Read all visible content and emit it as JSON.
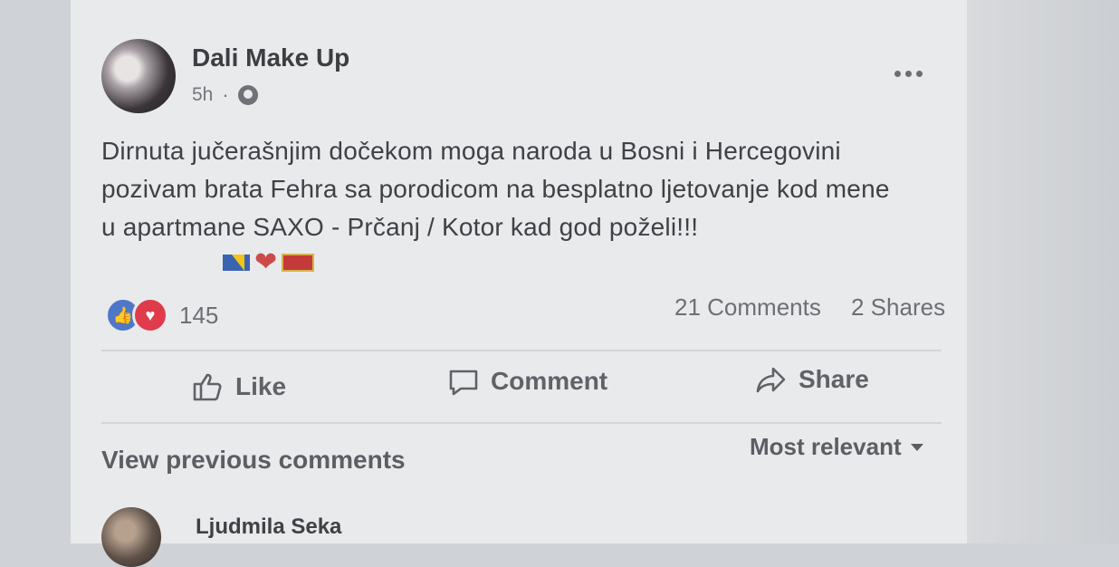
{
  "post": {
    "author": "Dali Make Up",
    "time": "5h",
    "separator": "·",
    "text_lines": [
      "Dirnuta jučerašnjim dočekom moga naroda u Bosni i Hercegovini",
      "pozivam brata Fehra sa porodicom na besplatno ljetovanje kod mene",
      "u apartmane SAXO - Prčanj / Kotor kad god poželi!!!"
    ],
    "emoji": [
      "bosnia-flag",
      "red-heart",
      "montenegro-flag"
    ]
  },
  "stats": {
    "reactions_count": "145",
    "comments": "21 Comments",
    "shares": "2 Shares"
  },
  "actions": {
    "like": "Like",
    "comment": "Comment",
    "share": "Share"
  },
  "comments_section": {
    "view_previous": "View previous comments",
    "sort_label": "Most relevant",
    "first_commenter": "Ljudmila Seka"
  },
  "icons": {
    "like_reaction": "👍",
    "love_reaction": "♥",
    "heart": "❤"
  }
}
